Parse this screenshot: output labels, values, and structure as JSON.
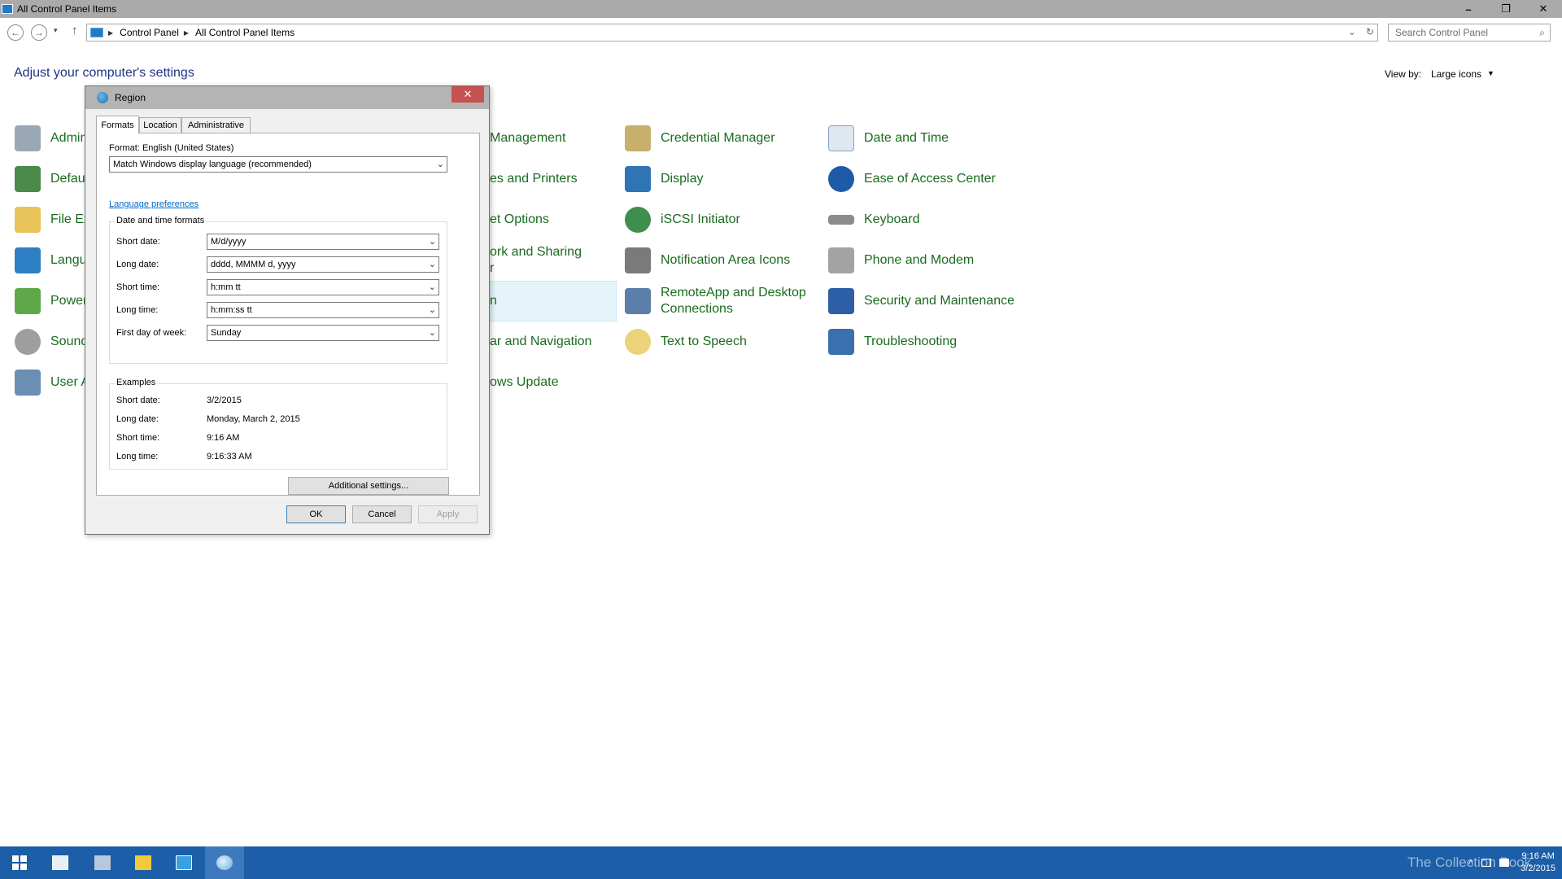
{
  "window": {
    "title": "All Control Panel Items",
    "minimize_glyph": "–",
    "maximize_glyph": "❐",
    "close_glyph": "✕"
  },
  "address": {
    "back_glyph": "←",
    "forward_glyph": "→",
    "recent_glyph": "▾",
    "up_glyph": "↑",
    "crumbs": [
      "Control Panel",
      "All Control Panel Items"
    ],
    "separator_glyph": "▶",
    "dropdown_glyph": "⌄",
    "refresh_glyph": "↻",
    "search_placeholder": "Search Control Panel",
    "search_glyph": "⌕"
  },
  "content": {
    "heading": "Adjust your computer's settings",
    "view_by_label": "View by:",
    "view_by_value": "Large icons",
    "view_by_arrow": "▼"
  },
  "items_col1": [
    "Admin",
    "Defau",
    "File Ex",
    "Langu",
    "Power",
    "Sound",
    "User A"
  ],
  "items_col2": [
    "Management",
    "es and Printers",
    "et Options",
    "ork and Sharing",
    "r",
    "n",
    "ar and Navigation",
    "ows Update"
  ],
  "items_col3": [
    "Credential Manager",
    "Display",
    "iSCSI Initiator",
    "Notification Area Icons",
    "RemoteApp and Desktop",
    "Connections",
    "Text to Speech"
  ],
  "items_col4": [
    "Date and Time",
    "Ease of Access Center",
    "Keyboard",
    "Phone and Modem",
    "Security and Maintenance",
    "Troubleshooting"
  ],
  "dialog": {
    "title": "Region",
    "close_glyph": "✕",
    "tabs": [
      "Formats",
      "Location",
      "Administrative"
    ],
    "format_label": "Format: English (United States)",
    "format_value": "Match Windows display language (recommended)",
    "language_link": "Language preferences",
    "dt_group_title": "Date and time formats",
    "fields": [
      {
        "label": "Short date:",
        "value": "M/d/yyyy"
      },
      {
        "label": "Long date:",
        "value": "dddd, MMMM d, yyyy"
      },
      {
        "label": "Short time:",
        "value": "h:mm tt"
      },
      {
        "label": "Long time:",
        "value": "h:mm:ss tt"
      },
      {
        "label": "First day of week:",
        "value": "Sunday"
      }
    ],
    "combo_arrow": "⌄",
    "examples_title": "Examples",
    "examples": [
      {
        "label": "Short date:",
        "value": "3/2/2015"
      },
      {
        "label": "Long date:",
        "value": "Monday, March 2, 2015"
      },
      {
        "label": "Short time:",
        "value": "9:16 AM"
      },
      {
        "label": "Long time:",
        "value": "9:16:33 AM"
      }
    ],
    "additional_settings": "Additional settings...",
    "ok": "OK",
    "cancel": "Cancel",
    "apply": "Apply"
  },
  "taskbar": {
    "watermark": "The Collection Book",
    "tray_up_glyph": "˄",
    "time": "9:16 AM",
    "date": "3/2/2015",
    "accent": "#1c5ea8"
  }
}
